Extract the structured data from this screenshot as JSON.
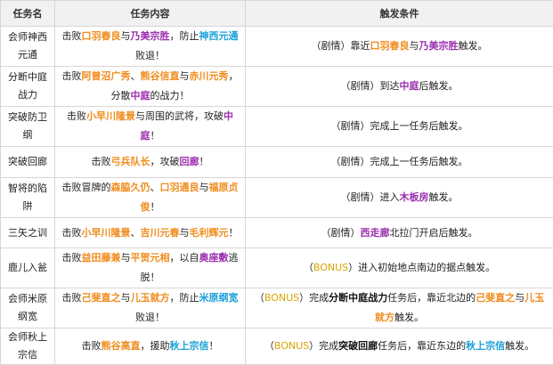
{
  "headers": [
    "任务名",
    "任务内容",
    "触发条件"
  ],
  "rows": [
    {
      "name": "会师神西元通",
      "content": [
        [
          "击败",
          ""
        ],
        [
          "口羽春良",
          "o"
        ],
        [
          "与",
          ""
        ],
        [
          "乃美宗胜",
          "p"
        ],
        [
          "，防止",
          ""
        ],
        [
          "神西元通",
          "b"
        ],
        [
          "败退！",
          ""
        ]
      ],
      "trigger": [
        [
          "（剧情）靠近",
          ""
        ],
        [
          "口羽春良",
          "o"
        ],
        [
          "与",
          ""
        ],
        [
          "乃美宗胜",
          "p"
        ],
        [
          "触发。",
          ""
        ]
      ]
    },
    {
      "name": "分断中庭战力",
      "content": [
        [
          "击败",
          ""
        ],
        [
          "阿曾沼广秀",
          "o"
        ],
        [
          "、",
          ""
        ],
        [
          "熊谷信直",
          "o"
        ],
        [
          "与",
          ""
        ],
        [
          "赤川元秀",
          "o"
        ],
        [
          "，分散",
          ""
        ],
        [
          "中庭",
          "p"
        ],
        [
          "的战力！",
          ""
        ]
      ],
      "trigger": [
        [
          "（剧情）到达",
          ""
        ],
        [
          "中庭",
          "p"
        ],
        [
          "后触发。",
          ""
        ]
      ]
    },
    {
      "name": "突破防卫纲",
      "content": [
        [
          "击败",
          ""
        ],
        [
          "小早川隆景",
          "o"
        ],
        [
          "与周围的武将，攻破",
          ""
        ],
        [
          "中庭",
          "p"
        ],
        [
          "！",
          ""
        ]
      ],
      "trigger": [
        [
          "（剧情）完成上一任务后触发。",
          ""
        ]
      ]
    },
    {
      "name": "突破回廊",
      "content": [
        [
          "击败",
          ""
        ],
        [
          "弓兵队长",
          "o"
        ],
        [
          "，攻破",
          ""
        ],
        [
          "回廊",
          "p"
        ],
        [
          "！",
          ""
        ]
      ],
      "trigger": [
        [
          "（剧情）完成上一任务后触发。",
          ""
        ]
      ]
    },
    {
      "name": "智将的陷阱",
      "content": [
        [
          "击败冒牌的",
          ""
        ],
        [
          "森脇久仍",
          "o"
        ],
        [
          "、",
          ""
        ],
        [
          "口羽通良",
          "o"
        ],
        [
          "与",
          ""
        ],
        [
          "福原贞俊",
          "o"
        ],
        [
          "！",
          ""
        ]
      ],
      "trigger": [
        [
          "（剧情）进入",
          ""
        ],
        [
          "木板房",
          "p"
        ],
        [
          "触发。",
          ""
        ]
      ]
    },
    {
      "name": "三矢之训",
      "content": [
        [
          "击败",
          ""
        ],
        [
          "小早川隆景",
          "o"
        ],
        [
          "、",
          ""
        ],
        [
          "吉川元春",
          "o"
        ],
        [
          "与",
          ""
        ],
        [
          "毛利辉元",
          "o"
        ],
        [
          "！",
          ""
        ]
      ],
      "trigger": [
        [
          "（剧情）",
          ""
        ],
        [
          "西走廊",
          "p"
        ],
        [
          "北拉门开启后触发。",
          ""
        ]
      ]
    },
    {
      "name": "鹿儿入瓮",
      "content": [
        [
          "击败",
          ""
        ],
        [
          "益田藤兼",
          "o"
        ],
        [
          "与",
          ""
        ],
        [
          "平贺元相",
          "o"
        ],
        [
          "，以自",
          ""
        ],
        [
          "奥座敷",
          "p"
        ],
        [
          "逃脱！",
          ""
        ]
      ],
      "trigger": [
        [
          "（",
          ""
        ],
        [
          "BONUS",
          "bonus"
        ],
        [
          "）进入初始地点南边的据点触发。",
          ""
        ]
      ]
    },
    {
      "name": "会师米原纲宽",
      "content": [
        [
          "击败",
          ""
        ],
        [
          "己斐直之",
          "o"
        ],
        [
          "与",
          ""
        ],
        [
          "儿玉就方",
          "o"
        ],
        [
          "，防止",
          ""
        ],
        [
          "米原纲宽",
          "b"
        ],
        [
          "败退！",
          ""
        ]
      ],
      "trigger": [
        [
          "（",
          ""
        ],
        [
          "BONUS",
          "bonus"
        ],
        [
          "）完成",
          ""
        ],
        [
          "分断中庭战力",
          "k"
        ],
        [
          "任务后，靠近北边的",
          ""
        ],
        [
          "己斐直之",
          "o"
        ],
        [
          "与",
          ""
        ],
        [
          "儿玉就方",
          "o"
        ],
        [
          "触发。",
          ""
        ]
      ]
    },
    {
      "name": "会师秋上宗信",
      "content": [
        [
          "击败",
          ""
        ],
        [
          "熊谷高直",
          "o"
        ],
        [
          "，援助",
          ""
        ],
        [
          "秋上宗信",
          "b"
        ],
        [
          "！",
          ""
        ]
      ],
      "trigger": [
        [
          "（",
          ""
        ],
        [
          "BONUS",
          "bonus"
        ],
        [
          "）完成",
          ""
        ],
        [
          "突破回廊",
          "k"
        ],
        [
          "任务后，靠近东边的",
          ""
        ],
        [
          "秋上宗信",
          "b"
        ],
        [
          "触发。",
          ""
        ]
      ]
    }
  ]
}
